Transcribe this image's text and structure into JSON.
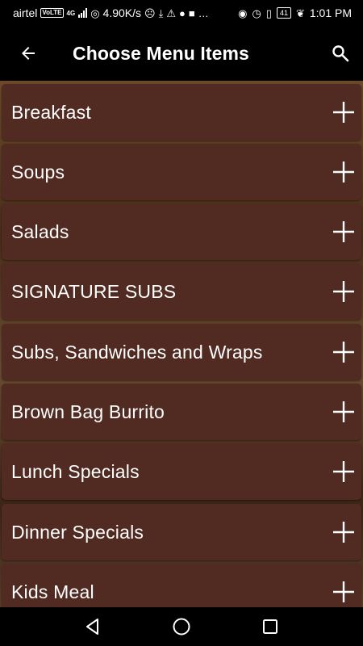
{
  "status_bar": {
    "carrier": "airtel",
    "volte_badge": "VoLTE",
    "network": "4G",
    "speed": "4.90K/s",
    "battery": "41",
    "time": "1:01 PM"
  },
  "app_bar": {
    "title": "Choose Menu Items",
    "back_icon": "arrow-left-icon",
    "search_icon": "search-icon"
  },
  "menu": {
    "items": [
      {
        "label": "Breakfast"
      },
      {
        "label": "Soups"
      },
      {
        "label": "Salads"
      },
      {
        "label": "SIGNATURE SUBS"
      },
      {
        "label": "Subs, Sandwiches and Wraps"
      },
      {
        "label": "Brown Bag Burrito"
      },
      {
        "label": "Lunch Specials"
      },
      {
        "label": "Dinner Specials"
      },
      {
        "label": "Kids Meal"
      }
    ]
  },
  "nav_bar": {
    "back_icon": "triangle-back-icon",
    "home_icon": "circle-home-icon",
    "recents_icon": "square-recents-icon"
  },
  "colors": {
    "item_background": "#512a22",
    "bar_background": "#000000",
    "text": "#ffffff"
  }
}
